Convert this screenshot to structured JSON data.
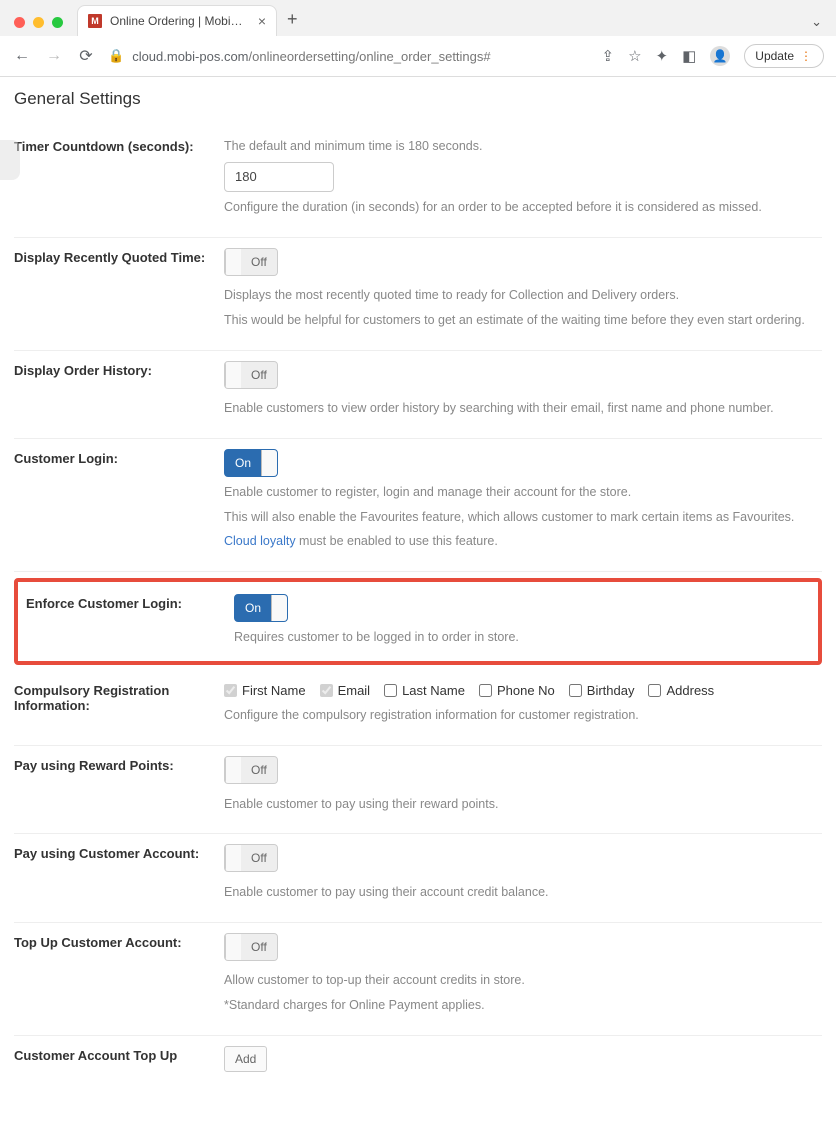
{
  "browser": {
    "tab_title": "Online Ordering | MobiPOS",
    "url_host": "cloud.mobi-pos.com",
    "url_path": "/onlineordersetting/online_order_settings#",
    "update_label": "Update"
  },
  "page_title": "General Settings",
  "settings": {
    "timer": {
      "label": "Timer Countdown (seconds):",
      "help_top": "The default and minimum time is 180 seconds.",
      "value": "180",
      "help": "Configure the duration (in seconds) for an order to be accepted before it is considered as missed."
    },
    "recently_quoted": {
      "label": "Display Recently Quoted Time:",
      "state": "Off",
      "help1": "Displays the most recently quoted time to ready for Collection and Delivery orders.",
      "help2": "This would be helpful for customers to get an estimate of the waiting time before they even start ordering."
    },
    "order_history": {
      "label": "Display Order History:",
      "state": "Off",
      "help": "Enable customers to view order history by searching with their email, first name and phone number."
    },
    "customer_login": {
      "label": "Customer Login:",
      "state": "On",
      "help1": "Enable customer to register, login and manage their account for the store.",
      "help2": "This will also enable the Favourites feature, which allows customer to mark certain items as Favourites.",
      "link_text": "Cloud loyalty",
      "help3_rest": " must be enabled to use this feature."
    },
    "enforce_login": {
      "label": "Enforce Customer Login:",
      "state": "On",
      "help": "Requires customer to be logged in to order in store."
    },
    "compulsory": {
      "label": "Compulsory Registration Information:",
      "options": [
        {
          "label": "First Name",
          "checked": true
        },
        {
          "label": "Email",
          "checked": true
        },
        {
          "label": "Last Name",
          "checked": false
        },
        {
          "label": "Phone No",
          "checked": false
        },
        {
          "label": "Birthday",
          "checked": false
        },
        {
          "label": "Address",
          "checked": false
        }
      ],
      "help": "Configure the compulsory registration information for customer registration."
    },
    "reward_points": {
      "label": "Pay using Reward Points:",
      "state": "Off",
      "help": "Enable customer to pay using their reward points."
    },
    "customer_account": {
      "label": "Pay using Customer Account:",
      "state": "Off",
      "help": "Enable customer to pay using their account credit balance."
    },
    "topup": {
      "label": "Top Up Customer Account:",
      "state": "Off",
      "help1": "Allow customer to top-up their account credits in store.",
      "help2": "*Standard charges for Online Payment applies."
    },
    "topup_option": {
      "label": "Customer Account Top Up",
      "button": "Add"
    }
  }
}
